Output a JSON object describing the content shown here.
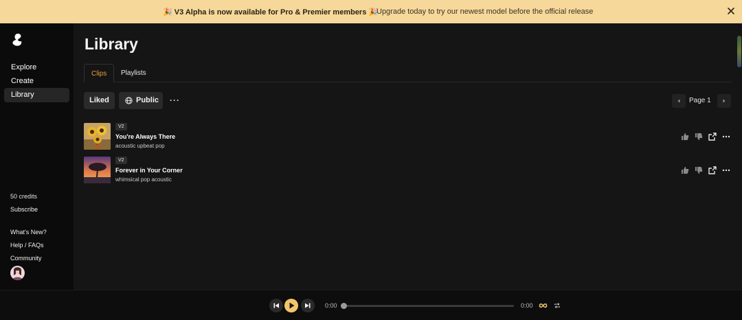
{
  "banner": {
    "highlight": "🎉 V3 Alpha is now available for Pro & Premier members 🎉",
    "message": "Upgrade today to try our newest model before the official release",
    "close_icon": "close-icon"
  },
  "sidebar": {
    "logo_icon": "brand-logo-icon",
    "nav": [
      {
        "label": "Explore"
      },
      {
        "label": "Create"
      },
      {
        "label": "Library"
      }
    ],
    "credits": "50 credits",
    "subscribe": "Subscribe",
    "links": [
      {
        "label": "What's New?"
      },
      {
        "label": "Help / FAQs"
      },
      {
        "label": "Community"
      }
    ]
  },
  "main": {
    "title": "Library",
    "tabs": [
      {
        "label": "Clips",
        "active": true
      },
      {
        "label": "Playlists",
        "active": false
      }
    ],
    "filters": {
      "liked": "Liked",
      "public": "Public",
      "more": "···"
    },
    "pager": {
      "label": "Page 1"
    },
    "songs": [
      {
        "version": "V2",
        "title": "You're Always There",
        "tags": "acoustic upbeat pop",
        "thumb": "sunflower-image"
      },
      {
        "version": "V2",
        "title": "Forever in Your Corner",
        "tags": "whimsical pop acoustic",
        "thumb": "sunset-tree-image"
      }
    ]
  },
  "player": {
    "current_time": "0:00",
    "duration": "0:00",
    "progress": 0,
    "loop_icon": "infinity-icon",
    "repeat_icon": "repeat-icon"
  },
  "colors": {
    "banner_bg": "#f6d89a",
    "accent": "#e8a13c",
    "play_button": "#f3c56b"
  }
}
